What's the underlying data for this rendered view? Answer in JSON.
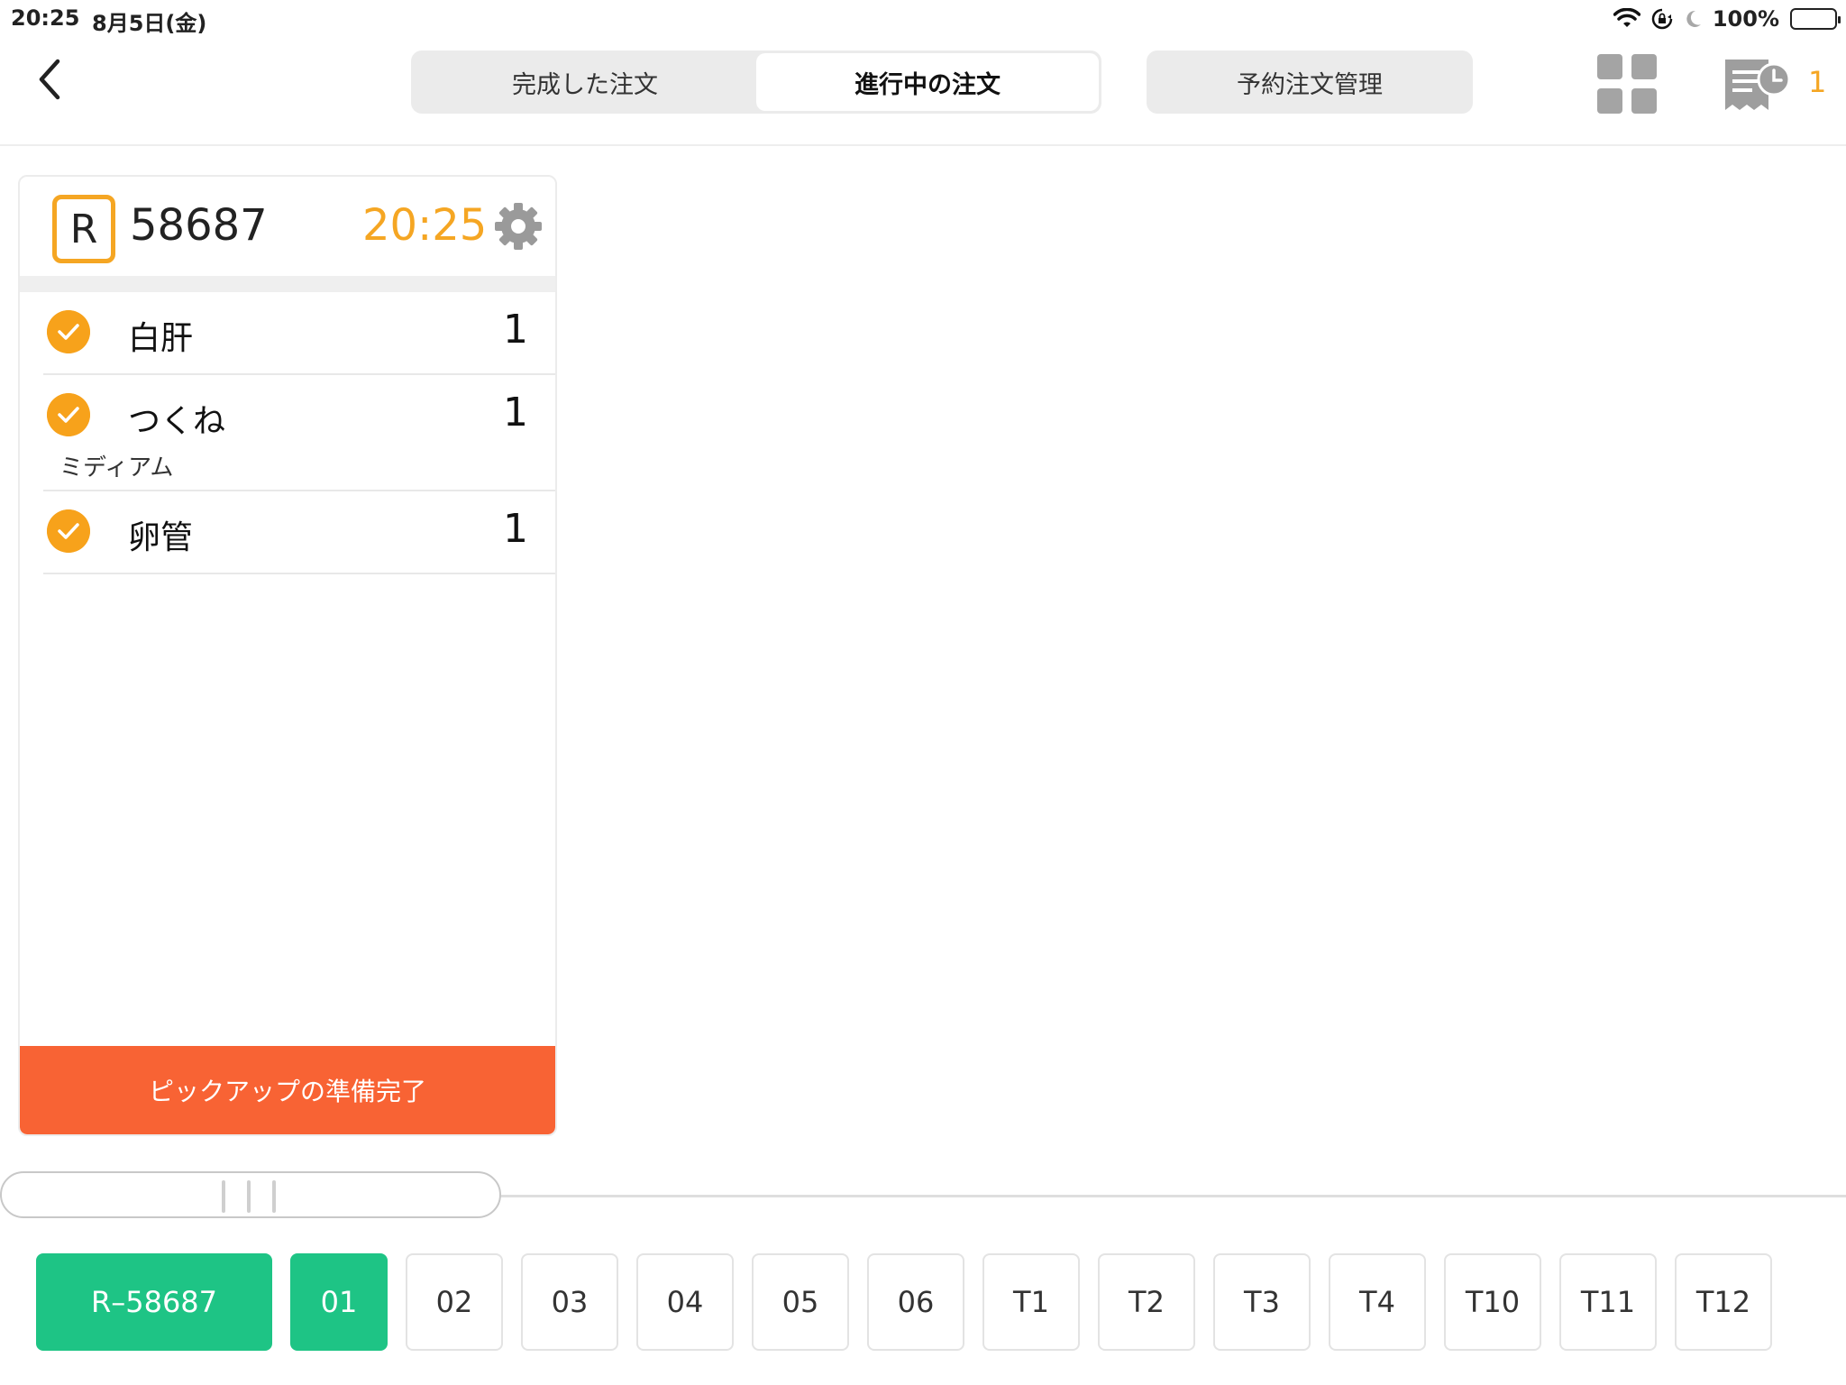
{
  "status_bar": {
    "time": "20:25",
    "date": "8月5日(金)",
    "battery": "100%"
  },
  "nav": {
    "tabs": [
      {
        "label": "完成した注文",
        "active": false
      },
      {
        "label": "進行中の注文",
        "active": true
      }
    ],
    "reservation_label": "予約注文管理",
    "pending_count": "1"
  },
  "order": {
    "prefix": "R",
    "number": "58687",
    "time": "20:25",
    "items": [
      {
        "name": "白肝",
        "qty": "1",
        "modifier": ""
      },
      {
        "name": "つくね",
        "qty": "1",
        "modifier": "ミディアム"
      },
      {
        "name": "卵管",
        "qty": "1",
        "modifier": ""
      }
    ],
    "pickup_label": "ピックアップの準備完了"
  },
  "tables": [
    "R–58687",
    "01",
    "02",
    "03",
    "04",
    "05",
    "06",
    "T1",
    "T2",
    "T3",
    "T4",
    "T10",
    "T11",
    "T12"
  ],
  "colors": {
    "accent_orange": "#f5a623",
    "pickup_red": "#f86334",
    "active_green": "#1ec485"
  }
}
